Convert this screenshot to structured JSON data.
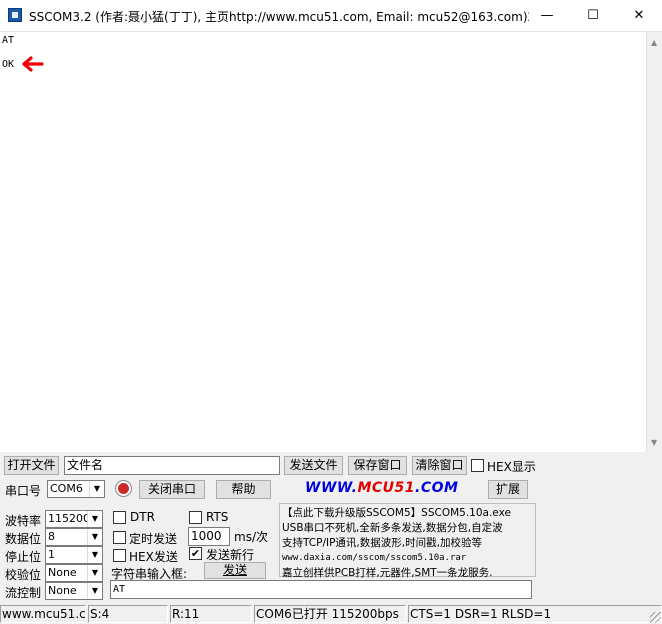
{
  "window": {
    "title": "SSCOM3.2 (作者:聂小猛(丁丁), 主页http://www.mcu51.com,  Email: mcu52@163.com)2...",
    "minimize_glyph": "—",
    "maximize_glyph": "☐",
    "close_glyph": "✕"
  },
  "terminal": {
    "lines": [
      "AT",
      "OK"
    ],
    "arrow_color": "#e8000b"
  },
  "toolbar": {
    "open_file": "打开文件",
    "filename_value": "文件名",
    "send_file": "发送文件",
    "save_window": "保存窗口",
    "clear_window": "清除窗口",
    "hex_display": "HEX显示"
  },
  "port": {
    "label": "串口号",
    "value": "COM6",
    "close_port": "关闭串口",
    "help": "帮助",
    "expand": "扩展"
  },
  "brand": {
    "prefix": "WWW.",
    "highlight": "MCU51",
    "suffix": ".COM"
  },
  "settings": {
    "baud_label": "波特率",
    "baud_value": "115200",
    "databits_label": "数据位",
    "databits_value": "8",
    "stopbits_label": "停止位",
    "stopbits_value": "1",
    "parity_label": "校验位",
    "parity_value": "None",
    "flow_label": "流控制",
    "flow_value": "None"
  },
  "send": {
    "dtr": "DTR",
    "rts": "RTS",
    "timed_send": "定时发送",
    "interval_value": "1000",
    "interval_unit": "ms/次",
    "hex_send": "HEX发送",
    "new_line": "发送新行",
    "new_line_checked": "✔",
    "input_label": "字符串输入框:",
    "send_button": "发送",
    "input_value": "AT"
  },
  "ad": {
    "line1": "【点此下载升级版SSCOM5】SSCOM5.10a.exe",
    "line2": "USB串口不死机,全新多条发送,数据分包,自定波",
    "line3": "支持TCP/IP通讯,数据波形,时间戳,加校验等",
    "line4": "www.daxia.com/sscom/sscom5.10a.rar",
    "line5": "嘉立创样供PCB打样,元器件,SMT一条龙服务."
  },
  "status": {
    "site": "www.mcu51.com",
    "sent": "S:4",
    "received": "R:11",
    "port_state": "COM6已打开  115200bps",
    "signals": "CTS=1 DSR=1 RLSD=1"
  }
}
